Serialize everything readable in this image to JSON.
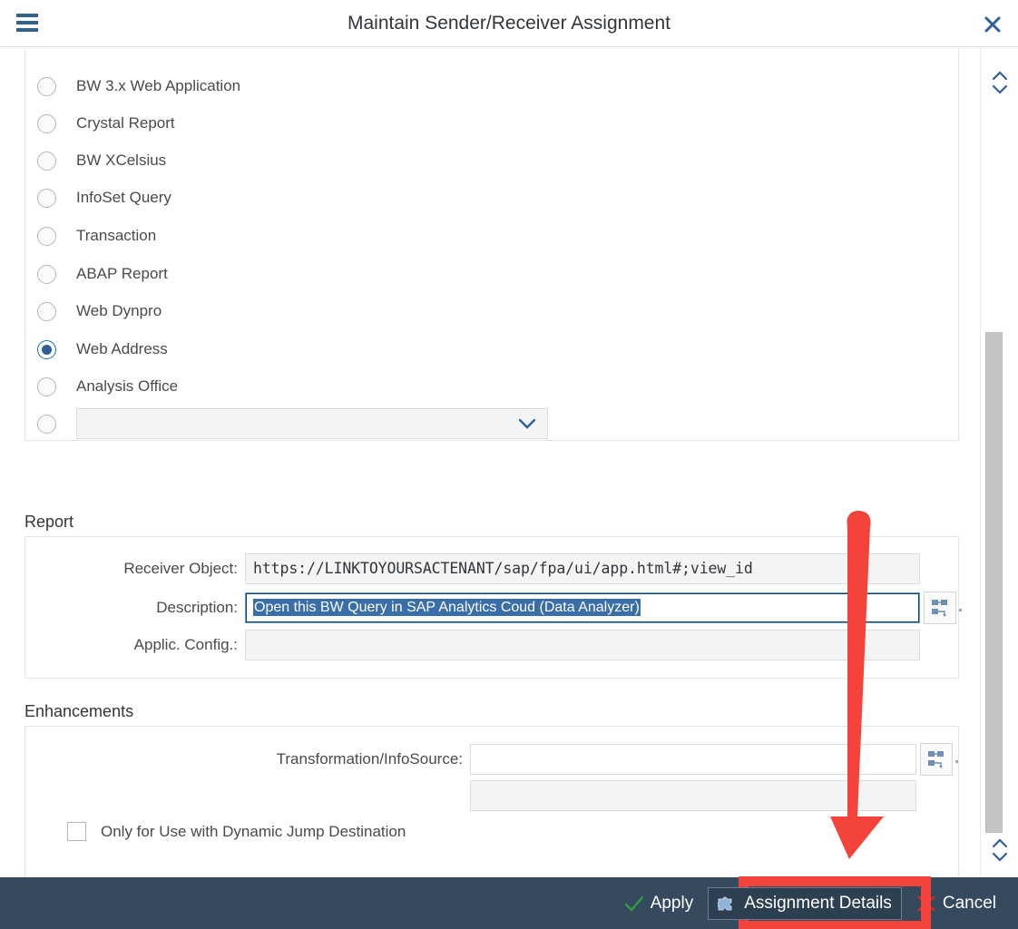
{
  "window": {
    "title": "Maintain Sender/Receiver Assignment",
    "menu_icon": "hamburger-icon",
    "close_icon": "close-icon"
  },
  "report_type": {
    "options": [
      {
        "label": "BW 3.x Web Application",
        "selected": false
      },
      {
        "label": "Crystal Report",
        "selected": false
      },
      {
        "label": "BW XCelsius",
        "selected": false
      },
      {
        "label": "InfoSet Query",
        "selected": false
      },
      {
        "label": "Transaction",
        "selected": false
      },
      {
        "label": "ABAP Report",
        "selected": false
      },
      {
        "label": "Web Dynpro",
        "selected": false
      },
      {
        "label": "Web Address",
        "selected": true
      },
      {
        "label": "Analysis Office",
        "selected": false
      }
    ],
    "custom_dropdown": {
      "value": "",
      "placeholder": "",
      "icon": "chevron-down-icon",
      "selected": false
    }
  },
  "report_section": {
    "title": "Report",
    "fields": [
      {
        "label": "Receiver Object:",
        "value": "https://LINKTOYOURSACTENANT/sap/fpa/ui/app.html#;view_id",
        "focused": false,
        "has_value_help": false
      },
      {
        "label": "Description:",
        "value": "Open this BW Query in SAP Analytics Coud (Data Analyzer)",
        "focused": true,
        "selected": true,
        "has_value_help": true,
        "value_help_icon": "hierarchy-value-help-icon"
      },
      {
        "label": "Applic. Config.:",
        "value": "",
        "focused": false,
        "has_value_help": false
      }
    ]
  },
  "enhancements_section": {
    "title": "Enhancements",
    "fields": [
      {
        "label": "Transformation/InfoSource:",
        "value": "",
        "has_value_help": true,
        "value_help_icon": "hierarchy-value-help-icon"
      },
      {
        "label": "",
        "value": "",
        "has_value_help": false
      }
    ],
    "checkbox": {
      "label": "Only for Use with Dynamic Jump Destination",
      "checked": false
    }
  },
  "scroll": {
    "up_icon": "chevron-up-icon",
    "down_icon": "chevron-down-icon"
  },
  "footer": {
    "apply_label": "Apply",
    "apply_icon": "check-icon",
    "assignment_details_label": "Assignment Details",
    "assignment_details_icon": "puzzle-piece-icon",
    "cancel_label": "Cancel",
    "cancel_icon": "cross-icon"
  },
  "annotations": {
    "arrow_color": "#f4433a",
    "highlight_color": "#f4433a",
    "arrow_points_to": "Assignment Details"
  },
  "colors": {
    "accent_blue": "#0a6ed1",
    "footer_bg": "#354a5f",
    "selection_blue": "#3a6ea8",
    "text": "#32363a"
  }
}
